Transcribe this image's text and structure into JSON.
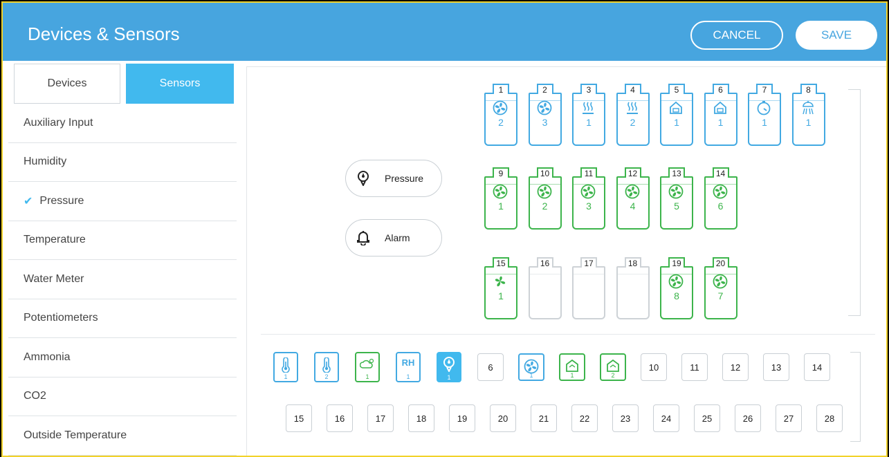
{
  "header": {
    "title": "Devices & Sensors",
    "cancel": "CANCEL",
    "save": "SAVE"
  },
  "tabs": {
    "devices": "Devices",
    "sensors": "Sensors"
  },
  "menu": [
    {
      "label": "Auxiliary Input"
    },
    {
      "label": "Humidity"
    },
    {
      "label": "Pressure",
      "checked": "✔"
    },
    {
      "label": "Temperature"
    },
    {
      "label": "Water Meter"
    },
    {
      "label": "Potentiometers"
    },
    {
      "label": "Ammonia"
    },
    {
      "label": "CO2"
    },
    {
      "label": "Outside Temperature"
    }
  ],
  "pills": {
    "pressure": "Pressure",
    "alarm": "Alarm"
  },
  "devices": [
    {
      "num": "1",
      "icon": "fan-icon",
      "count": "2",
      "state": "blue"
    },
    {
      "num": "2",
      "icon": "fan-icon",
      "count": "3",
      "state": "blue"
    },
    {
      "num": "3",
      "icon": "heater-icon",
      "count": "1",
      "state": "blue"
    },
    {
      "num": "4",
      "icon": "heater-icon",
      "count": "2",
      "state": "blue"
    },
    {
      "num": "5",
      "icon": "inlet-icon",
      "count": "1",
      "state": "blue"
    },
    {
      "num": "6",
      "icon": "inlet-icon",
      "count": "1",
      "state": "blue"
    },
    {
      "num": "7",
      "icon": "timer-icon",
      "count": "1",
      "state": "blue"
    },
    {
      "num": "8",
      "icon": "sprinkler-icon",
      "count": "1",
      "state": "blue"
    },
    {
      "num": "9",
      "icon": "fan-icon",
      "count": "1",
      "state": "green"
    },
    {
      "num": "10",
      "icon": "fan-icon",
      "count": "2",
      "state": "green"
    },
    {
      "num": "11",
      "icon": "fan-icon",
      "count": "3",
      "state": "green"
    },
    {
      "num": "12",
      "icon": "fan-icon",
      "count": "4",
      "state": "green"
    },
    {
      "num": "13",
      "icon": "fan-icon",
      "count": "5",
      "state": "green"
    },
    {
      "num": "14",
      "icon": "fan-icon",
      "count": "6",
      "state": "green"
    },
    {
      "num": "15",
      "icon": "stir-fan-icon",
      "count": "1",
      "state": "green"
    },
    {
      "num": "16",
      "icon": "",
      "count": "",
      "state": "grey"
    },
    {
      "num": "17",
      "icon": "",
      "count": "",
      "state": "grey"
    },
    {
      "num": "18",
      "icon": "",
      "count": "",
      "state": "grey"
    },
    {
      "num": "19",
      "icon": "fan-icon",
      "count": "8",
      "state": "green"
    },
    {
      "num": "20",
      "icon": "fan-icon",
      "count": "7",
      "state": "green"
    }
  ],
  "sensors": [
    {
      "label": "",
      "icon": "thermometer-icon",
      "sub": "1",
      "state": "blue"
    },
    {
      "label": "",
      "icon": "thermometer-icon",
      "sub": "2",
      "state": "blue"
    },
    {
      "label": "",
      "icon": "weather-icon",
      "sub": "1",
      "state": "green"
    },
    {
      "label": "RH",
      "icon": "",
      "sub": "1",
      "state": "blue"
    },
    {
      "label": "",
      "icon": "pressure-icon",
      "sub": "1",
      "state": "filled"
    },
    {
      "label": "6",
      "icon": "",
      "sub": "",
      "state": "plain"
    },
    {
      "label": "",
      "icon": "fan-icon",
      "sub": "1",
      "state": "blue"
    },
    {
      "label": "",
      "icon": "house-icon",
      "sub": "1",
      "state": "green"
    },
    {
      "label": "",
      "icon": "house-icon",
      "sub": "2",
      "state": "green"
    },
    {
      "label": "10",
      "icon": "",
      "sub": "",
      "state": "plain"
    },
    {
      "label": "11",
      "icon": "",
      "sub": "",
      "state": "plain"
    },
    {
      "label": "12",
      "icon": "",
      "sub": "",
      "state": "plain"
    },
    {
      "label": "13",
      "icon": "",
      "sub": "",
      "state": "plain"
    },
    {
      "label": "14",
      "icon": "",
      "sub": "",
      "state": "plain"
    },
    {
      "label": "15",
      "icon": "",
      "sub": "",
      "state": "plain"
    },
    {
      "label": "16",
      "icon": "",
      "sub": "",
      "state": "plain"
    },
    {
      "label": "17",
      "icon": "",
      "sub": "",
      "state": "plain"
    },
    {
      "label": "18",
      "icon": "",
      "sub": "",
      "state": "plain"
    },
    {
      "label": "19",
      "icon": "",
      "sub": "",
      "state": "plain"
    },
    {
      "label": "20",
      "icon": "",
      "sub": "",
      "state": "plain"
    },
    {
      "label": "21",
      "icon": "",
      "sub": "",
      "state": "plain"
    },
    {
      "label": "22",
      "icon": "",
      "sub": "",
      "state": "plain"
    },
    {
      "label": "23",
      "icon": "",
      "sub": "",
      "state": "plain"
    },
    {
      "label": "24",
      "icon": "",
      "sub": "",
      "state": "plain"
    },
    {
      "label": "25",
      "icon": "",
      "sub": "",
      "state": "plain"
    },
    {
      "label": "26",
      "icon": "",
      "sub": "",
      "state": "plain"
    },
    {
      "label": "27",
      "icon": "",
      "sub": "",
      "state": "plain"
    },
    {
      "label": "28",
      "icon": "",
      "sub": "",
      "state": "plain"
    }
  ],
  "colors": {
    "header": "#47a5df",
    "accent": "#41b9ee",
    "device_blue": "#42a9e2",
    "device_green": "#3cb44b"
  }
}
